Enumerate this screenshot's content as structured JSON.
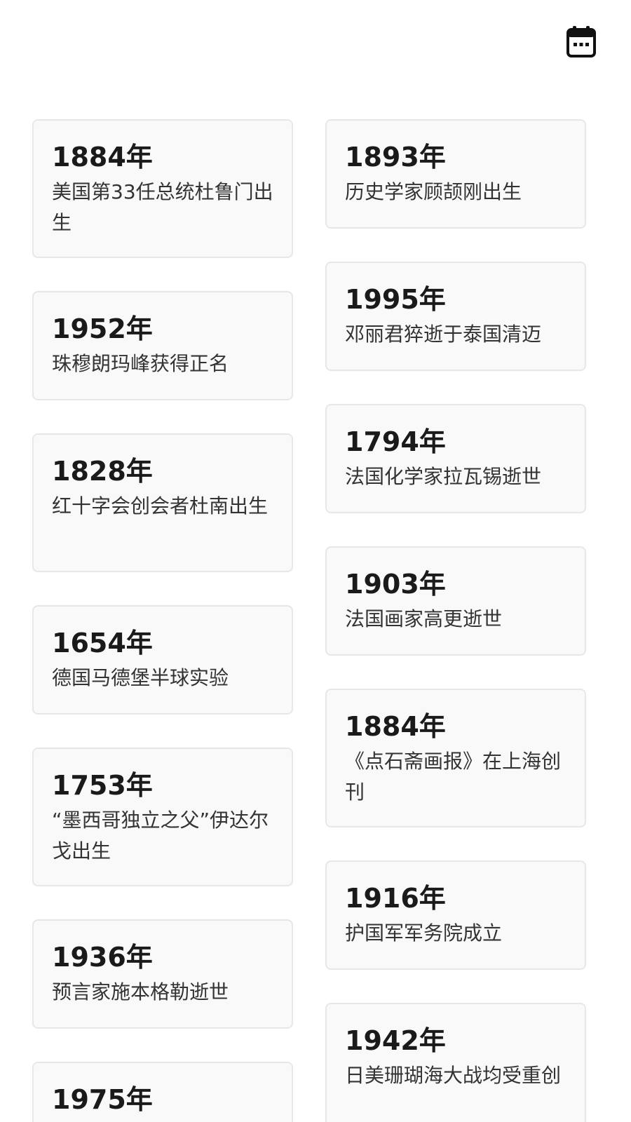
{
  "header": {
    "calendar_icon": "calendar-icon"
  },
  "columns": {
    "left": [
      {
        "year": "1884年",
        "event": "美国第33任总统杜鲁门出生"
      },
      {
        "year": "1952年",
        "event": "珠穆朗玛峰获得正名"
      },
      {
        "year": "1828年",
        "event": "红十字会创会者杜南出生"
      },
      {
        "year": "1654年",
        "event": "德国马德堡半球实验"
      },
      {
        "year": "1753年",
        "event": "“墨西哥独立之父”伊达尔戈出生"
      },
      {
        "year": "1936年",
        "event": "预言家施本格勒逝世"
      },
      {
        "year": "1975年",
        "event": ""
      }
    ],
    "right": [
      {
        "year": "1893年",
        "event": "历史学家顾颉刚出生"
      },
      {
        "year": "1995年",
        "event": "邓丽君猝逝于泰国清迈"
      },
      {
        "year": "1794年",
        "event": "法国化学家拉瓦锡逝世"
      },
      {
        "year": "1903年",
        "event": "法国画家高更逝世"
      },
      {
        "year": "1884年",
        "event": "《点石斋画报》在上海创刊"
      },
      {
        "year": "1916年",
        "event": "护国军军务院成立"
      },
      {
        "year": "1942年",
        "event": "日美珊瑚海大战均受重创"
      }
    ]
  }
}
